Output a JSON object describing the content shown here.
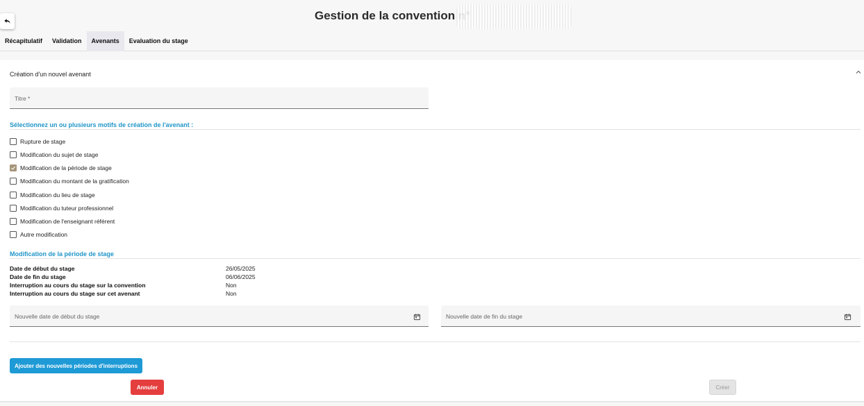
{
  "header": {
    "title": "Gestion de la convention n°",
    "back_icon": "undo-arrow-icon"
  },
  "tabs": [
    {
      "label": "Récapitulatif",
      "active": false
    },
    {
      "label": "Validation",
      "active": false
    },
    {
      "label": "Avenants",
      "active": true
    },
    {
      "label": "Evaluation du stage",
      "active": false
    }
  ],
  "panel": {
    "title": "Création d'un nouvel avenant",
    "titre_field": {
      "placeholder": "Titre *",
      "value": ""
    },
    "motifs_heading": "Sélectionnez un ou plusieurs motifs de création de l'avenant :",
    "motifs": [
      {
        "label": "Rupture de stage",
        "checked": false
      },
      {
        "label": "Modification du sujet de stage",
        "checked": false
      },
      {
        "label": "Modification de la période de stage",
        "checked": true
      },
      {
        "label": "Modification du montant de la gratification",
        "checked": false
      },
      {
        "label": "Modification du lieu de stage",
        "checked": false
      },
      {
        "label": "Modification du tuteur professionnel",
        "checked": false
      },
      {
        "label": "Modification de l'enseignant référent",
        "checked": false
      },
      {
        "label": "Autre modification",
        "checked": false
      }
    ],
    "periode_heading": "Modification de la période de stage",
    "periode_info": [
      {
        "label": "Date de début du stage",
        "value": "26/05/2025"
      },
      {
        "label": "Date de fin du stage",
        "value": "06/06/2025"
      },
      {
        "label": "Interruption au cours du stage sur la convention",
        "value": "Non"
      },
      {
        "label": "Interruption au cours du stage sur cet avenant",
        "value": "Non"
      }
    ],
    "new_start_field": {
      "placeholder": "Nouvelle date de début du stage",
      "icon": "calendar-icon"
    },
    "new_end_field": {
      "placeholder": "Nouvelle date de fin du stage",
      "icon": "calendar-icon"
    },
    "add_interruptions_label": "Ajouter des nouvelles périodes d'interruptions",
    "cancel_label": "Annuler",
    "create_label": "Créer"
  },
  "colors": {
    "accent": "#2196c9",
    "primary_button": "#1e9ad6",
    "danger_button": "#e53e3e",
    "checked_checkbox": "#a6957a"
  }
}
